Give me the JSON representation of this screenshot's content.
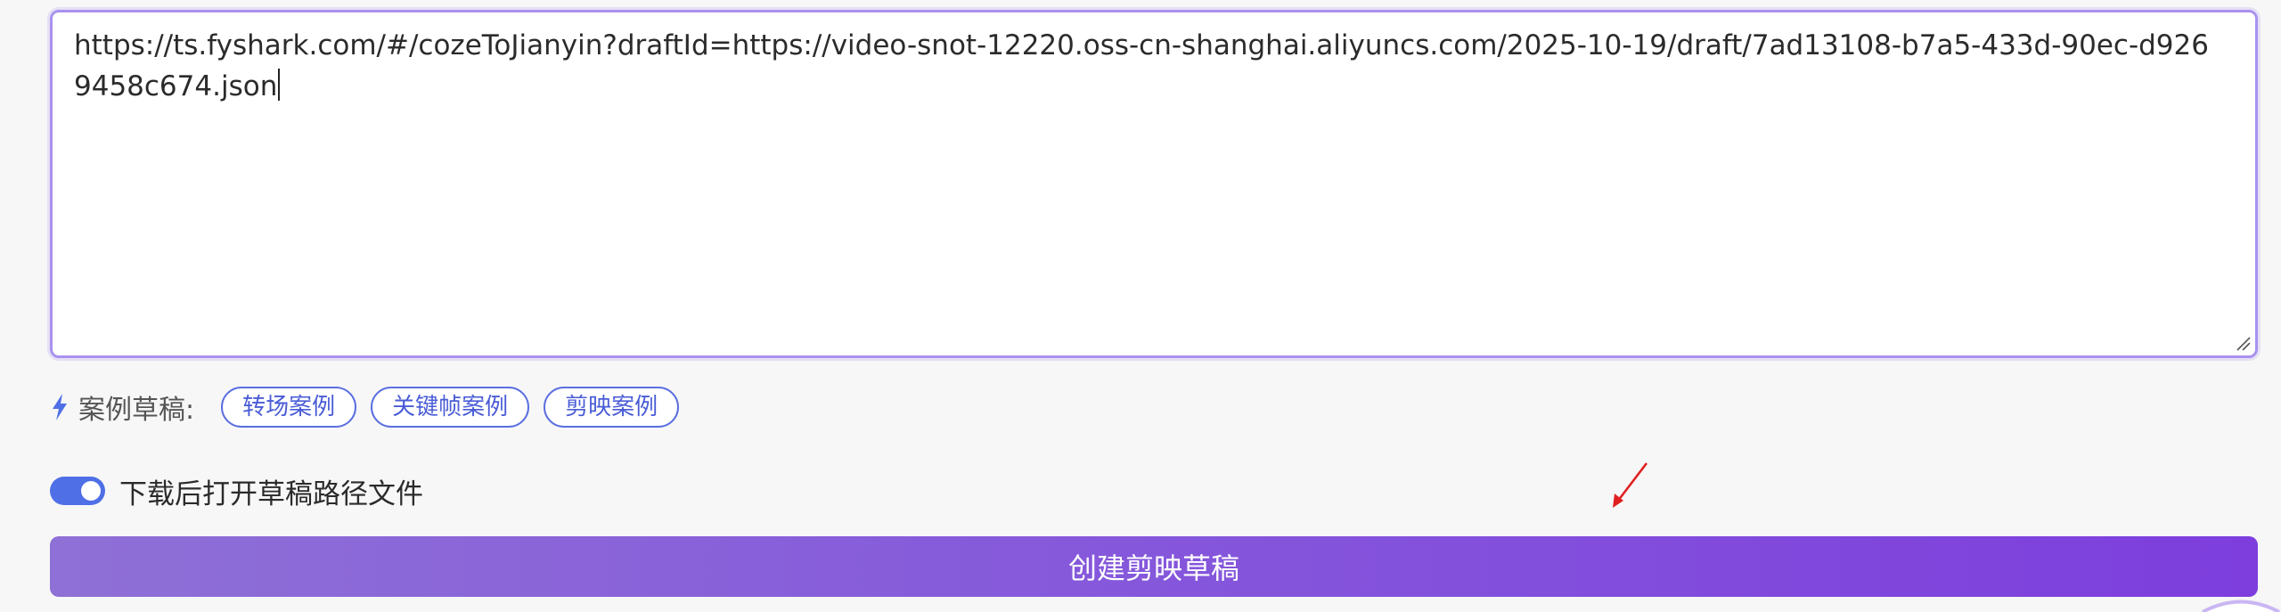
{
  "url_input": {
    "value": "https://ts.fyshark.com/#/cozeToJianyin?draftId=https://video-snot-12220.oss-cn-shanghai.aliyuncs.com/2025-10-19/draft/7ad13108-b7a5-433d-90ec-d9269458c674.json"
  },
  "examples": {
    "icon": "lightning-bolt-icon",
    "label": "案例草稿:",
    "chips": [
      {
        "label": "转场案例"
      },
      {
        "label": "关键帧案例"
      },
      {
        "label": "剪映案例"
      }
    ]
  },
  "open_after_download": {
    "label": "下载后打开草稿路径文件",
    "enabled": true
  },
  "create_button": {
    "label": "创建剪映草稿"
  },
  "colors": {
    "accent": "#4f6fe6",
    "button_gradient_start": "#8e70d6",
    "button_gradient_end": "#7d3edd",
    "annotation_arrow": "#e02020"
  }
}
